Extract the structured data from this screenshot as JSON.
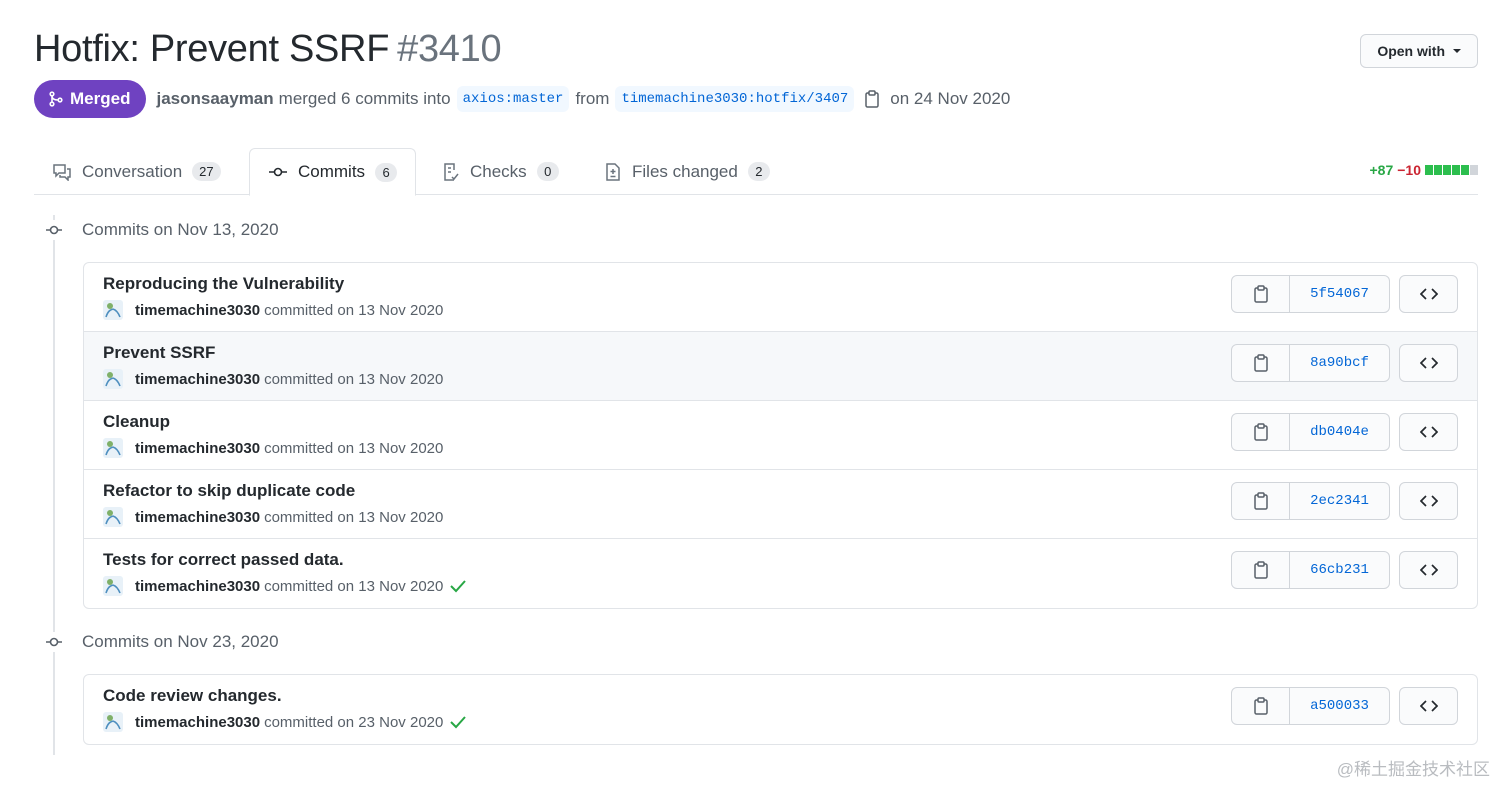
{
  "header": {
    "title": "Hotfix: Prevent SSRF",
    "number": "#3410",
    "open_with_label": "Open with",
    "status": "Merged",
    "author": "jasonsaayman",
    "merged_text": "merged 6 commits into",
    "base_branch": "axios:master",
    "from_text": "from",
    "head_branch": "timemachine3030:hotfix/3407",
    "merged_date": "on 24 Nov 2020"
  },
  "tabs": [
    {
      "label": "Conversation",
      "count": "27",
      "icon": "comment-discussion-icon"
    },
    {
      "label": "Commits",
      "count": "6",
      "icon": "git-commit-icon"
    },
    {
      "label": "Checks",
      "count": "0",
      "icon": "checklist-icon"
    },
    {
      "label": "Files changed",
      "count": "2",
      "icon": "file-diff-icon"
    }
  ],
  "diffstat": {
    "additions": "+87",
    "deletions": "−10",
    "add_color": "#28a745",
    "del_color": "#cb2431"
  },
  "groups": [
    {
      "heading": "Commits on Nov 13, 2020",
      "commits": [
        {
          "title": "Reproducing the Vulnerability",
          "author": "timemachine3030",
          "date": "committed on 13 Nov 2020",
          "sha": "5f54067",
          "checked": false
        },
        {
          "title": "Prevent SSRF",
          "author": "timemachine3030",
          "date": "committed on 13 Nov 2020",
          "sha": "8a90bcf",
          "checked": false
        },
        {
          "title": "Cleanup",
          "author": "timemachine3030",
          "date": "committed on 13 Nov 2020",
          "sha": "db0404e",
          "checked": false
        },
        {
          "title": "Refactor to skip duplicate code",
          "author": "timemachine3030",
          "date": "committed on 13 Nov 2020",
          "sha": "2ec2341",
          "checked": false
        },
        {
          "title": "Tests for correct passed data.",
          "author": "timemachine3030",
          "date": "committed on 13 Nov 2020",
          "sha": "66cb231",
          "checked": true
        }
      ]
    },
    {
      "heading": "Commits on Nov 23, 2020",
      "commits": [
        {
          "title": "Code review changes.",
          "author": "timemachine3030",
          "date": "committed on 23 Nov 2020",
          "sha": "a500033",
          "checked": true
        }
      ]
    }
  ],
  "watermark": "@稀土掘金技术社区"
}
